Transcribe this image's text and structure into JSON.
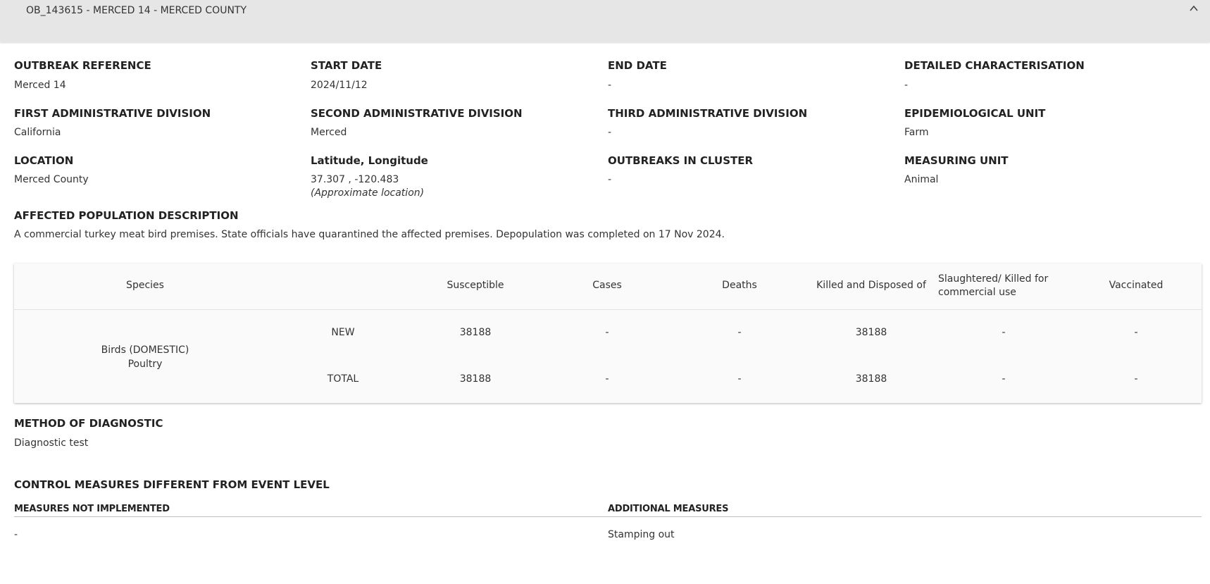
{
  "header": {
    "title": "OB_143615 - MERCED 14 - MERCED COUNTY"
  },
  "fields": {
    "outbreak_reference": {
      "label": "OUTBREAK REFERENCE",
      "value": "Merced 14"
    },
    "start_date": {
      "label": "START DATE",
      "value": "2024/11/12"
    },
    "end_date": {
      "label": "END DATE",
      "value": "-"
    },
    "detailed_characterisation": {
      "label": "DETAILED CHARACTERISATION",
      "value": "-"
    },
    "first_admin": {
      "label": "FIRST ADMINISTRATIVE DIVISION",
      "value": "California"
    },
    "second_admin": {
      "label": "SECOND ADMINISTRATIVE DIVISION",
      "value": "Merced"
    },
    "third_admin": {
      "label": "THIRD ADMINISTRATIVE DIVISION",
      "value": "-"
    },
    "epi_unit": {
      "label": "EPIDEMIOLOGICAL UNIT",
      "value": "Farm"
    },
    "location": {
      "label": "LOCATION",
      "value": "Merced County"
    },
    "lat_long": {
      "label": "Latitude, Longitude",
      "value": "37.307 , -120.483",
      "note": "(Approximate location)"
    },
    "outbreaks_in_cluster": {
      "label": "OUTBREAKS IN CLUSTER",
      "value": "-"
    },
    "measuring_unit": {
      "label": "MEASURING UNIT",
      "value": "Animal"
    }
  },
  "affected_population": {
    "label": "AFFECTED POPULATION DESCRIPTION",
    "text": "A commercial turkey meat bird premises. State officials have quarantined the affected premises. Depopulation was completed on 17 Nov 2024."
  },
  "table": {
    "headers": {
      "species": "Species",
      "susceptible": "Susceptible",
      "cases": "Cases",
      "deaths": "Deaths",
      "killed": "Killed and Disposed of",
      "slaughtered": "Slaughtered/ Killed for commercial use",
      "vaccinated": "Vaccinated"
    },
    "species_line1": "Birds (DOMESTIC)",
    "species_line2": "Poultry",
    "rows": [
      {
        "type": "NEW",
        "susceptible": "38188",
        "cases": "-",
        "deaths": "-",
        "killed": "38188",
        "slaughtered": "-",
        "vaccinated": "-"
      },
      {
        "type": "TOTAL",
        "susceptible": "38188",
        "cases": "-",
        "deaths": "-",
        "killed": "38188",
        "slaughtered": "-",
        "vaccinated": "-"
      }
    ]
  },
  "diagnostic": {
    "label": "METHOD OF DIAGNOSTIC",
    "value": "Diagnostic test"
  },
  "control_measures": {
    "label": "CONTROL MEASURES DIFFERENT FROM EVENT LEVEL",
    "not_implemented_label": "MEASURES NOT IMPLEMENTED",
    "not_implemented_value": "-",
    "additional_label": "ADDITIONAL MEASURES",
    "additional_value": "Stamping out"
  },
  "icons": {
    "collapse": "chevron-up-icon"
  }
}
